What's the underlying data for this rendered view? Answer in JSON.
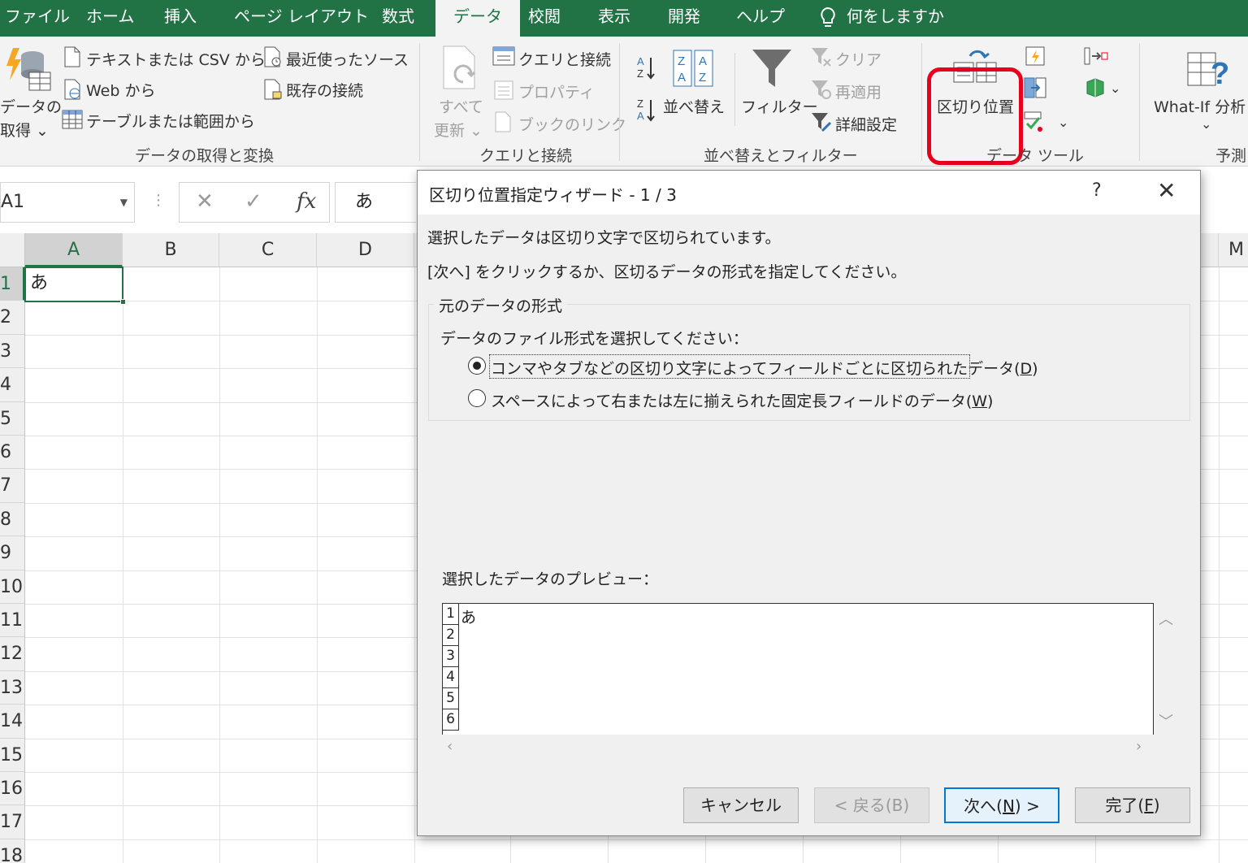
{
  "ribbon_tabs": [
    "ファイル",
    "ホーム",
    "挿入",
    "ページ レイアウト",
    "数式",
    "データ",
    "校閲",
    "表示",
    "開発",
    "ヘルプ"
  ],
  "tell_me": "何をしますか",
  "ribbon": {
    "get_data_line1": "データの",
    "get_data_line2": "取得 ⌄",
    "from_text_csv": "テキストまたは CSV から",
    "from_web": "Web から",
    "from_table": "テーブルまたは範囲から",
    "recent_sources": "最近使ったソース",
    "existing_connections": "既存の接続",
    "group_get_transform": "データの取得と変換",
    "refresh_all_line1": "すべて",
    "refresh_all_line2": "更新 ⌄",
    "queries_connections": "クエリと接続",
    "properties": "プロパティ",
    "workbook_links": "ブックのリンク",
    "group_queries": "クエリと接続",
    "sort": "並べ替え",
    "filter": "フィルター",
    "clear": "クリア",
    "reapply": "再適用",
    "advanced": "詳細設定",
    "group_sort_filter": "並べ替えとフィルター",
    "text_to_columns": "区切り位置",
    "group_data_tools": "データ ツール",
    "what_if": "What-If 分析",
    "what_if_arrow": "⌄",
    "group_forecast": "予測"
  },
  "formula_bar": {
    "name_box": "A1",
    "cancel_symbol": "✕",
    "enter_symbol": "✓",
    "fx_symbol": "fx",
    "content": "あ"
  },
  "grid": {
    "columns": [
      "A",
      "B",
      "C",
      "D",
      "M"
    ],
    "rows": [
      "1",
      "2",
      "3",
      "4",
      "5",
      "6",
      "7",
      "8",
      "9",
      "10",
      "11",
      "12",
      "13",
      "14",
      "15",
      "16",
      "17",
      "18"
    ],
    "cell_a1": "あ"
  },
  "dialog": {
    "title": "区切り位置指定ウィザード - 1 / 3",
    "help": "?",
    "close": "✕",
    "intro1": "選択したデータは区切り文字で区切られています。",
    "intro2": "[次へ] をクリックするか、区切るデータの形式を指定してください。",
    "group_title": "元のデータの形式",
    "prompt": "データのファイル形式を選択してください：",
    "option_delimited_text": "コンマやタブなどの区切り文字によってフィールドごとに区切られたデータ(",
    "option_delimited_key": "D",
    "option_fixed_text": "スペースによって右または左に揃えられた固定長フィールドのデータ(",
    "option_fixed_key": "W",
    "close_paren": ")",
    "selected_option": "delimited",
    "preview_label": "選択したデータのプレビュー：",
    "preview_rows": [
      "1",
      "2",
      "3",
      "4",
      "5",
      "6"
    ],
    "preview_first_value": "あ",
    "btn_cancel": "キャンセル",
    "btn_back": "< 戻る(B)",
    "btn_next_pre": "次へ(",
    "btn_next_key": "N",
    "btn_next_post": ") >",
    "btn_finish_pre": "完了(",
    "btn_finish_key": "F",
    "btn_finish_post": ")"
  },
  "colors": {
    "excel_green": "#217346",
    "highlight_red": "#e8001c",
    "default_button_border": "#0078d7"
  }
}
